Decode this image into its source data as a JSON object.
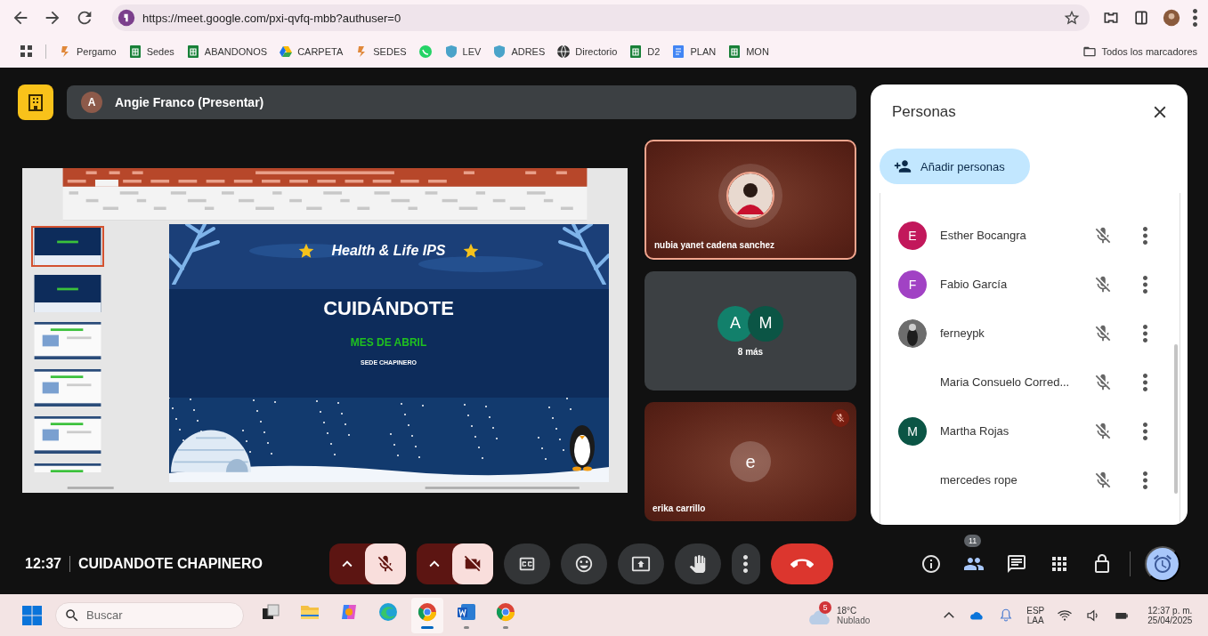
{
  "browser": {
    "url": "https://meet.google.com/pxi-qvfq-mbb?authuser=0",
    "bookmarks": [
      {
        "label": "Pergamo",
        "kind": "favicon"
      },
      {
        "label": "Sedes",
        "kind": "sheet"
      },
      {
        "label": "ABANDONOS",
        "kind": "sheet"
      },
      {
        "label": "CARPETA",
        "kind": "drive"
      },
      {
        "label": "SEDES",
        "kind": "favicon"
      },
      {
        "kind": "whatsapp"
      },
      {
        "label": "LEV",
        "kind": "shield"
      },
      {
        "label": "ADRES",
        "kind": "shield"
      },
      {
        "label": "Directorio",
        "kind": "globe"
      },
      {
        "label": "D2",
        "kind": "sheet"
      },
      {
        "label": "PLAN",
        "kind": "doc"
      },
      {
        "label": "MON",
        "kind": "sheet"
      }
    ],
    "bookmarks_folder": "Todos los marcadores"
  },
  "presenter_bar": {
    "avatar_letter": "A",
    "name": "Angie Franco (Presentar)"
  },
  "presentation": {
    "slide": {
      "brand": "Health & Life IPS",
      "title": "CUIDÁNDOTE",
      "subtitle": "MES DE ABRIL",
      "location": "SEDE CHAPINERO"
    },
    "thumbnails": [
      {
        "selected": true
      },
      {
        "selected": false
      },
      {
        "selected": false
      },
      {
        "selected": false
      },
      {
        "selected": false
      },
      {
        "selected": false
      }
    ]
  },
  "tiles": [
    {
      "kind": "photo",
      "name": "nubia yanet cadena sanchez",
      "highlighted": true,
      "muted": false
    },
    {
      "kind": "group",
      "avatars": [
        {
          "letter": "A",
          "color": "#12806b"
        },
        {
          "letter": "M",
          "color": "#0b5545"
        }
      ],
      "label": "8 más",
      "highlighted": false,
      "muted": false
    },
    {
      "kind": "letter",
      "letter": "e",
      "name": "erika carrillo",
      "highlighted": false,
      "muted": true
    }
  ],
  "people_panel": {
    "title": "Personas",
    "add_button": "Añadir personas",
    "participants": [
      {
        "name": "Esther Bocangra",
        "kind": "letter",
        "letter": "E",
        "color": "#c2185b",
        "muted": true
      },
      {
        "name": "Fabio García",
        "kind": "letter",
        "letter": "F",
        "color": "#a142c4",
        "muted": true
      },
      {
        "name": "ferneypk",
        "kind": "photo",
        "muted": true
      },
      {
        "name": "Maria Consuelo Corred...",
        "kind": "none",
        "muted": true
      },
      {
        "name": "Martha Rojas",
        "kind": "letter",
        "letter": "M",
        "color": "#0b5545",
        "muted": true
      },
      {
        "name": "mercedes rope",
        "kind": "none",
        "muted": true
      }
    ]
  },
  "controls": {
    "time": "12:37",
    "meeting_name": "CUIDANDOTE CHAPINERO",
    "mic": {
      "muted": true
    },
    "camera": {
      "off": true
    },
    "people_count": "11",
    "people_active": true
  },
  "taskbar": {
    "search_placeholder": "Buscar",
    "apps": [
      {
        "kind": "taskview",
        "running": false
      },
      {
        "kind": "explorer",
        "running": false
      },
      {
        "kind": "copilot",
        "running": false
      },
      {
        "kind": "edge",
        "running": false
      },
      {
        "kind": "chrome",
        "running": true,
        "active": true
      },
      {
        "kind": "word",
        "running": true,
        "active": false
      },
      {
        "kind": "chrome",
        "running": true,
        "active": false
      }
    ],
    "weather": {
      "badge": "5",
      "temperature": "18°C",
      "condition": "Nublado"
    },
    "language": "ESP",
    "layout": "LAA",
    "clock_time": "12:37 p. m.",
    "clock_date": "25/04/2025"
  }
}
